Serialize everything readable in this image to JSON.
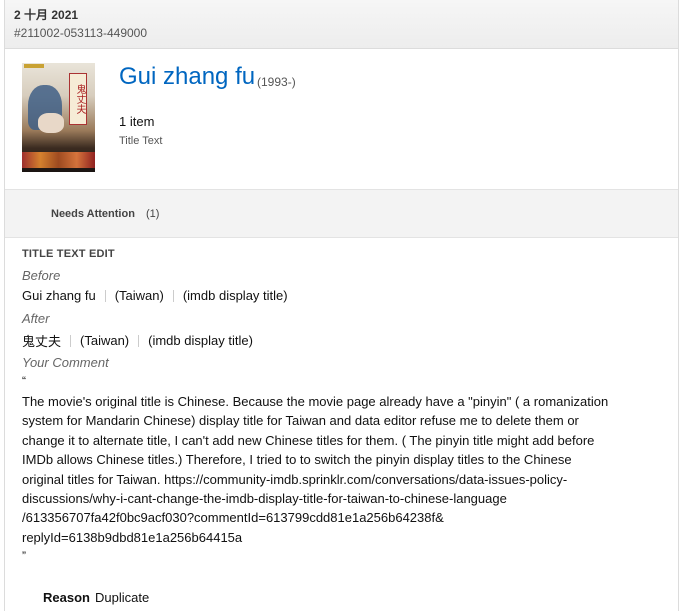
{
  "header": {
    "date": "2 十月 2021",
    "submission_id": "#211002-053113-449000"
  },
  "title_card": {
    "title": "Gui zhang fu",
    "year": "(1993-)",
    "item_count": "1 item",
    "item_type": "Title Text",
    "poster_text": "鬼丈夫"
  },
  "needs_attention": {
    "label": "Needs Attention",
    "count": "(1)"
  },
  "edit": {
    "heading": "TITLE TEXT EDIT",
    "before_label": "Before",
    "before": {
      "title": "Gui zhang fu",
      "region": "(Taiwan)",
      "attribute": "(imdb display title)"
    },
    "after_label": "After",
    "after": {
      "title": "鬼丈夫",
      "region": "(Taiwan)",
      "attribute": "(imdb display title)"
    },
    "comment_label": "Your Comment",
    "open_quote": "“",
    "comment": "The movie's original title is Chinese. Because the movie page already have a \"pinyin\" ( a romanization\nsystem for Mandarin Chinese) display title for Taiwan and data editor refuse me to delete them or\nchange it to alternate title, I can't add new Chinese titles for them. ( The pinyin title might add before\nIMDb allows Chinese titles.) Therefore, I tried to to switch the pinyin display titles to the Chinese\noriginal titles for Taiwan. https://community-imdb.sprinklr.com/conversations/data-issues-policy-\ndiscussions/why-i-cant-change-the-imdb-display-title-for-taiwan-to-chinese-language\n/613356707fa42f0bc9acf030?commentId=613799cdd81e1a256b64238f&\nreplyId=6138b9dbd81e1a256b64415a",
    "close_quote": "”",
    "reason_label": "Reason",
    "reason": "Duplicate"
  }
}
